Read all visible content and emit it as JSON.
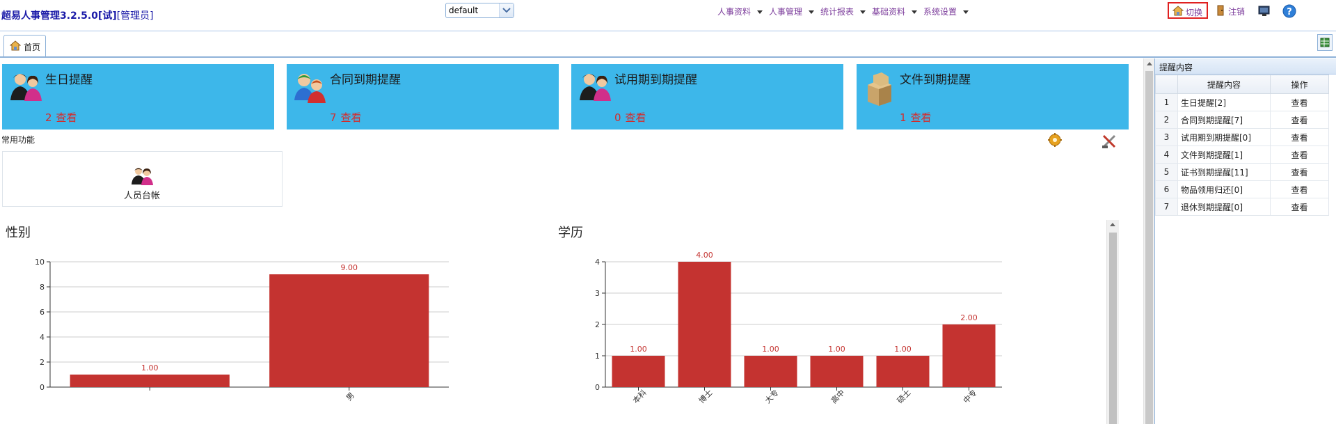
{
  "header": {
    "app_title": "超易人事管理3.2.5.0[试]",
    "role": "[管理员]",
    "theme_select": "default",
    "menu": [
      {
        "label": "人事资料"
      },
      {
        "label": "人事管理"
      },
      {
        "label": "统计报表"
      },
      {
        "label": "基础资料"
      },
      {
        "label": "系统设置"
      }
    ],
    "switch_label": "切换",
    "logout_label": "注销"
  },
  "tabs": [
    {
      "label": "首页"
    }
  ],
  "cards": [
    {
      "title": "生日提醒",
      "count": "2",
      "view": "查看"
    },
    {
      "title": "合同到期提醒",
      "count": "7",
      "view": "查看"
    },
    {
      "title": "试用期到期提醒",
      "count": "0",
      "view": "查看"
    },
    {
      "title": "文件到期提醒",
      "count": "1",
      "view": "查看"
    }
  ],
  "common": {
    "label": "常用功能",
    "items": [
      {
        "label": "人员台帐"
      }
    ]
  },
  "chart_data": [
    {
      "type": "bar",
      "title": "性别",
      "categories": [
        "",
        "男"
      ],
      "values": [
        1,
        9
      ],
      "value_labels": [
        "1.00",
        "9.00"
      ],
      "ylim": [
        0,
        10
      ],
      "yticks": [
        0,
        2,
        4,
        6,
        8,
        10
      ],
      "grid": true,
      "color": "#c43330"
    },
    {
      "type": "bar",
      "title": "学历",
      "categories": [
        "本科",
        "博士",
        "大专",
        "高中",
        "硕士",
        "中专"
      ],
      "values": [
        1,
        4,
        1,
        1,
        1,
        2
      ],
      "value_labels": [
        "1.00",
        "4.00",
        "1.00",
        "1.00",
        "1.00",
        "2.00"
      ],
      "ylim": [
        0,
        4
      ],
      "yticks": [
        0,
        1,
        2,
        3,
        4
      ],
      "grid": true,
      "color": "#c43330"
    }
  ],
  "reminder_panel": {
    "title": "提醒内容",
    "columns": [
      "",
      "提醒内容",
      "操作"
    ],
    "rows": [
      {
        "num": "1",
        "content": "生日提醒[2]",
        "action": "查看"
      },
      {
        "num": "2",
        "content": "合同到期提醒[7]",
        "action": "查看"
      },
      {
        "num": "3",
        "content": "试用期到期提醒[0]",
        "action": "查看"
      },
      {
        "num": "4",
        "content": "文件到期提醒[1]",
        "action": "查看"
      },
      {
        "num": "5",
        "content": "证书到期提醒[11]",
        "action": "查看"
      },
      {
        "num": "6",
        "content": "物品领用归还[0]",
        "action": "查看"
      },
      {
        "num": "7",
        "content": "退休到期提醒[0]",
        "action": "查看"
      }
    ]
  }
}
